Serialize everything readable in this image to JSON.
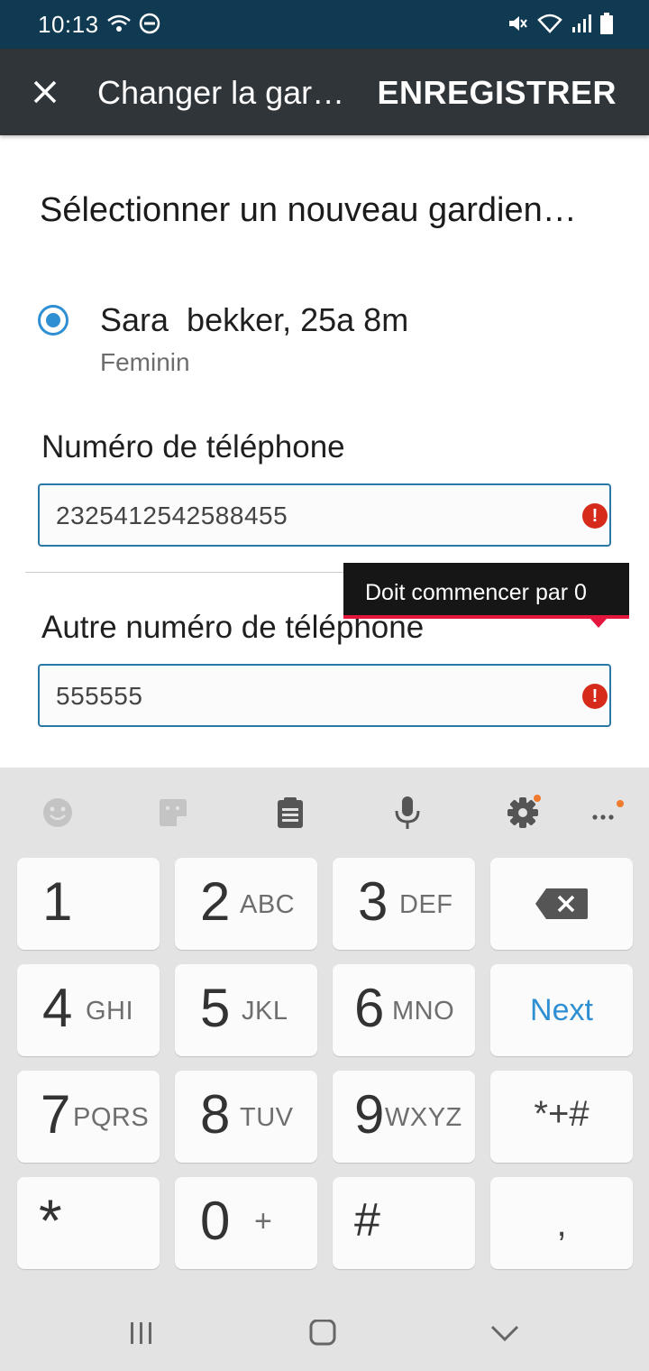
{
  "status_bar": {
    "time": "10:13"
  },
  "toolbar": {
    "title": "Changer la gar…",
    "save_label": "ENREGISTRER"
  },
  "main": {
    "heading": "Sélectionner un nouveau gardien…",
    "option": {
      "name": "Sara  bekker, 25a 8m",
      "gender": "Feminin",
      "selected": true
    },
    "phone": {
      "label": "Numéro de téléphone",
      "value": "2325412542588455"
    },
    "other_phone": {
      "label": "Autre numéro de téléphone",
      "value": "555555"
    },
    "tooltip": "Doit commencer par 0"
  },
  "keyboard": {
    "toolbar_icons": [
      "emoji-icon",
      "sticker-icon",
      "clipboard-icon",
      "microphone-icon",
      "settings-icon",
      "more-icon"
    ],
    "keys": [
      {
        "digit": "1",
        "letters": ""
      },
      {
        "digit": "2",
        "letters": "ABC"
      },
      {
        "digit": "3",
        "letters": "DEF"
      },
      {
        "digit": "4",
        "letters": "GHI"
      },
      {
        "digit": "5",
        "letters": "JKL"
      },
      {
        "digit": "6",
        "letters": "MNO"
      },
      {
        "digit": "7",
        "letters": "PQRS"
      },
      {
        "digit": "8",
        "letters": "TUV"
      },
      {
        "digit": "9",
        "letters": "WXYZ"
      },
      {
        "digit": "0",
        "letters": "+"
      }
    ],
    "next_label": "Next",
    "symbols_label": "*+#",
    "star_label": "*",
    "hash_label": "#",
    "comma_label": ","
  },
  "colors": {
    "accent": "#2e8fd3",
    "error": "#d62b1a",
    "toolbar": "#2f3539",
    "status_bar": "#103a52"
  }
}
